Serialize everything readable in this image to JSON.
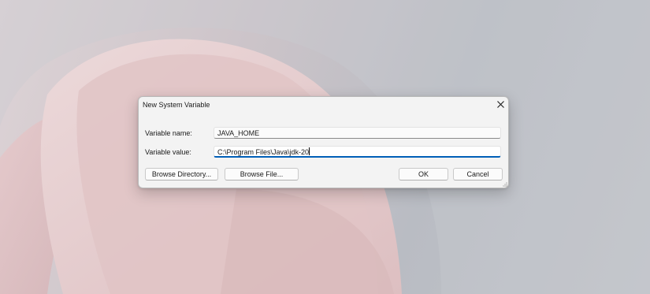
{
  "dialog": {
    "title": "New System Variable",
    "close_icon": "close-icon"
  },
  "fields": {
    "name_label": "Variable name:",
    "name_value": "JAVA_HOME",
    "value_label": "Variable value:",
    "value_value": "C:\\Program Files\\Java\\jdk-20"
  },
  "buttons": {
    "browse_directory": "Browse Directory...",
    "browse_file": "Browse File...",
    "ok": "OK",
    "cancel": "Cancel"
  },
  "colors": {
    "focus_accent": "#005fb8",
    "dialog_background": "#f3f3f3"
  }
}
